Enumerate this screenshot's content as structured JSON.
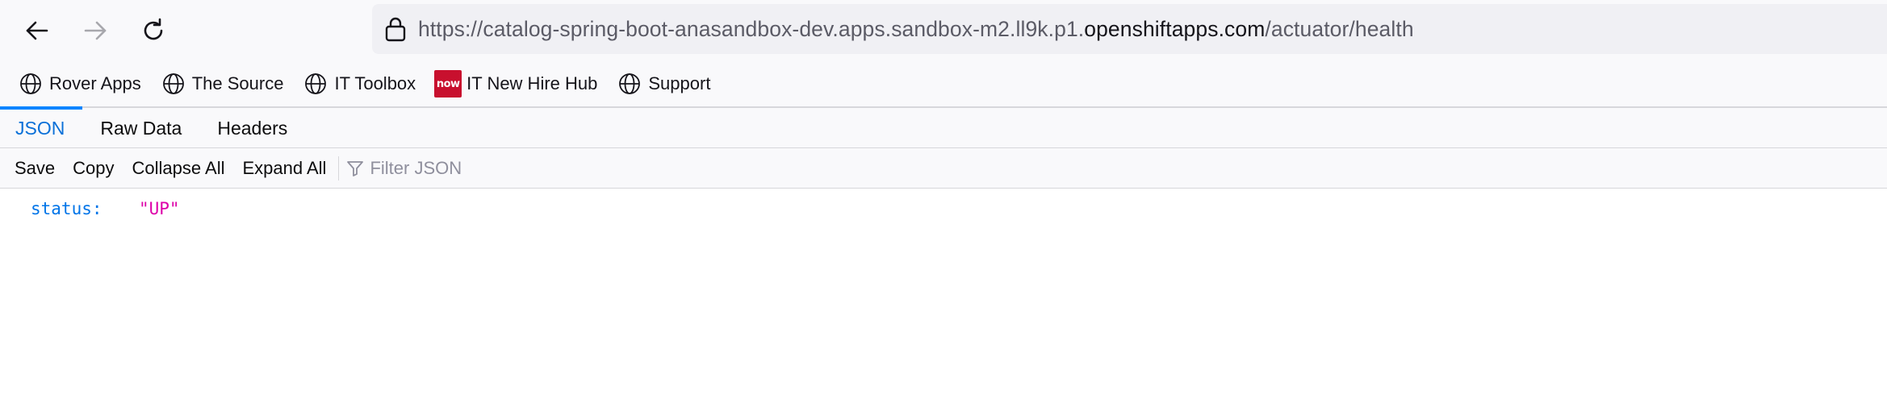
{
  "browser": {
    "url_prefix": "https://catalog-spring-boot-anasandbox-dev.apps.sandbox-m2.ll9k.p1.",
    "url_domain": "openshiftapps.com",
    "url_path": "/actuator/health"
  },
  "bookmarks": [
    {
      "label": "Rover Apps",
      "icon": "globe-icon"
    },
    {
      "label": "The Source",
      "icon": "globe-icon"
    },
    {
      "label": "IT Toolbox",
      "icon": "globe-icon"
    },
    {
      "label": "IT New Hire Hub",
      "icon": "now-logo-icon",
      "logo_text": "now"
    },
    {
      "label": "Support",
      "icon": "globe-icon"
    }
  ],
  "tabs": [
    {
      "label": "JSON",
      "active": true
    },
    {
      "label": "Raw Data",
      "active": false
    },
    {
      "label": "Headers",
      "active": false
    }
  ],
  "toolbar": {
    "save": "Save",
    "copy": "Copy",
    "collapse_all": "Collapse All",
    "expand_all": "Expand All",
    "filter_placeholder": "Filter JSON"
  },
  "json": {
    "key": "status:",
    "value": "\"UP\""
  },
  "colors": {
    "accent": "#0a84ff",
    "json_key": "#0074e8",
    "json_string": "#dd00a9",
    "now_logo": "#c8102e"
  }
}
